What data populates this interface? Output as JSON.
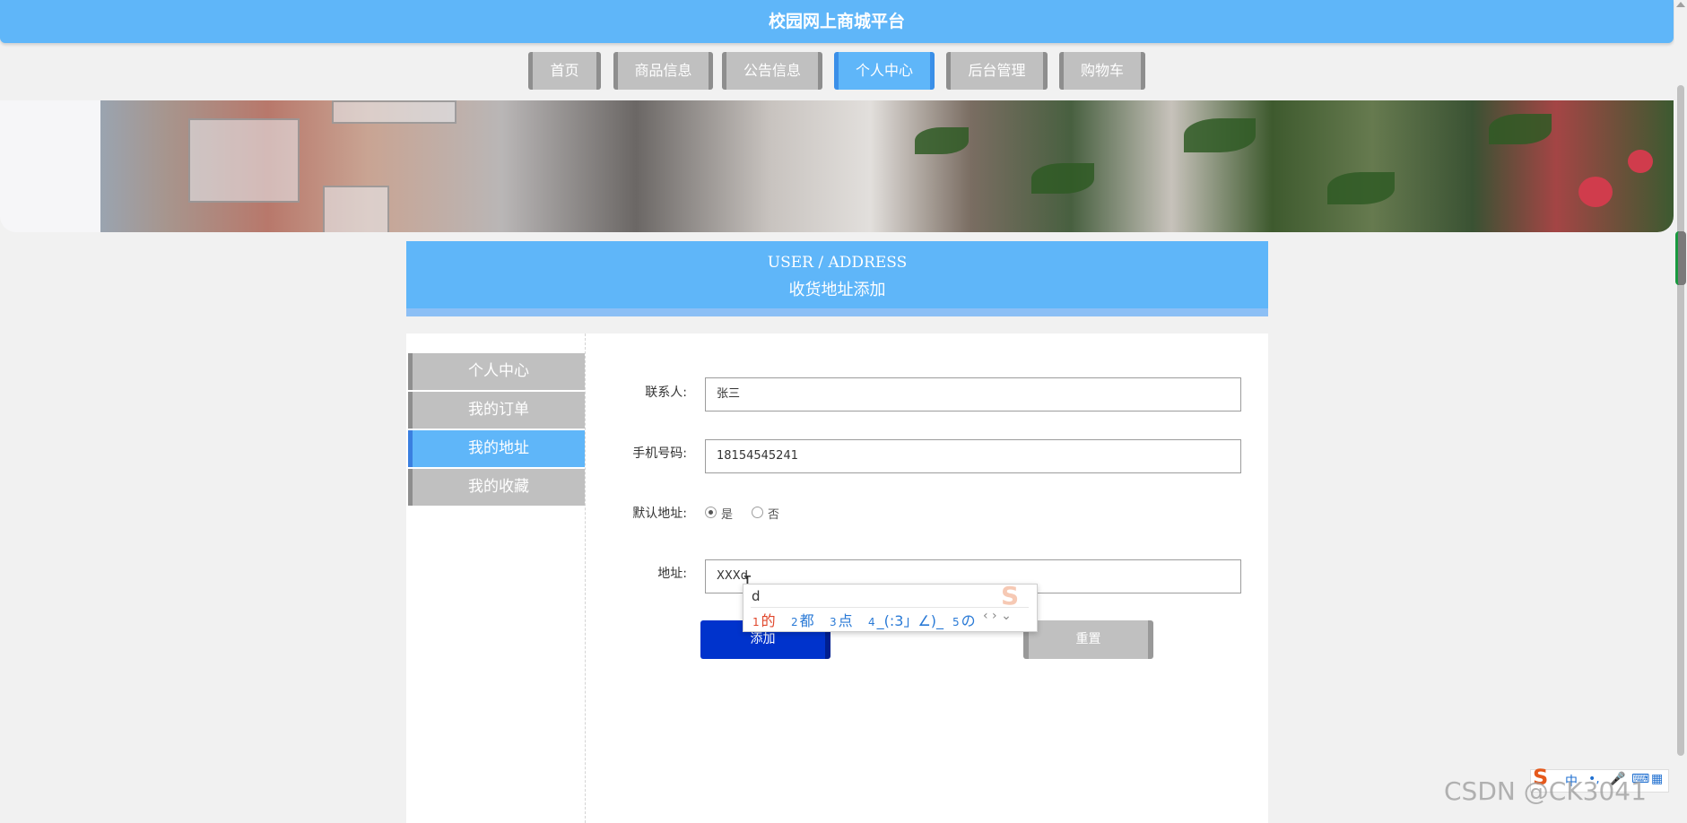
{
  "site": {
    "title": "校园网上商城平台"
  },
  "nav": {
    "items": [
      "首页",
      "商品信息",
      "公告信息",
      "个人中心",
      "后台管理",
      "购物车"
    ],
    "active": "个人中心"
  },
  "section": {
    "title_en": "USER / ADDRESS",
    "title_cn": "收货地址添加"
  },
  "sidebar": {
    "items": [
      "个人中心",
      "我的订单",
      "我的地址",
      "我的收藏"
    ],
    "active": "我的地址"
  },
  "form": {
    "contact": {
      "label": "联系人:",
      "value": "张三"
    },
    "phone": {
      "label": "手机号码:",
      "value": "18154545241"
    },
    "default": {
      "label": "默认地址:",
      "options": [
        "是",
        "否"
      ],
      "selected": "是"
    },
    "address": {
      "label": "地址:",
      "value": "XXXd"
    },
    "add_label": "添加",
    "reset_label": "重置"
  },
  "ime": {
    "composition": "d",
    "candidates": [
      {
        "n": "1",
        "text": "的"
      },
      {
        "n": "2",
        "text": "都"
      },
      {
        "n": "3",
        "text": "点"
      },
      {
        "n": "4",
        "text": "_(:3」∠)_"
      },
      {
        "n": "5",
        "text": "の"
      }
    ],
    "logo": "S"
  },
  "ime_toolbar": {
    "logo": "S",
    "lang": "中",
    "punct": "•,",
    "mic_icon": "mic-icon",
    "keyboard_icon": "keyboard-icon",
    "grid_icon": "grid-icon"
  },
  "watermark": "CSDN @CK3041",
  "colors": {
    "header_blue": "#5fb6f9",
    "nav_grey": "#c0c0c0",
    "add_button": "#0033cc"
  }
}
